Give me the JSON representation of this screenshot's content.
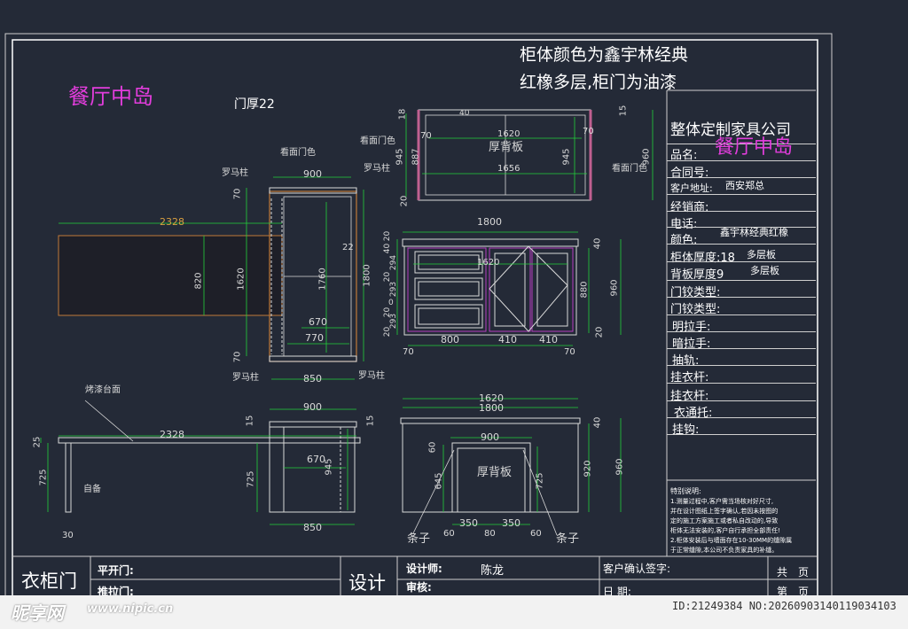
{
  "header": {
    "title_cn": "餐厅中岛",
    "door_thickness": "门厚22",
    "note_line1": "柜体颜色为鑫宇林经典",
    "note_line2": "红橡多层,柜门为油漆"
  },
  "plan_view": {
    "label_look_door_color": "看面门色",
    "label_roman_col_tl": "罗马柱",
    "label_roman_col_tr": "罗马柱",
    "label_roman_col_bl": "罗马柱",
    "label_roman_col_br": "罗马柱",
    "dim_900": "900",
    "dim_2328": "2328",
    "dim_820": "820",
    "dim_1620": "1620",
    "dim_1760": "1760",
    "dim_1800": "1800",
    "dim_22": "22",
    "dim_70_top": "70",
    "dim_70_bot": "70",
    "dim_670": "670",
    "dim_770": "770",
    "dim_850": "850"
  },
  "top_elev": {
    "label_look_door_left": "看面门色",
    "label_back_panel": "厚背板",
    "label_look_door_right": "看面门色",
    "dim_1620": "1620",
    "dim_1656": "1656",
    "dim_70_l": "70",
    "dim_70_r": "70",
    "dim_945_l": "945",
    "dim_945_r": "945",
    "dim_887": "887",
    "dim_960": "960",
    "dim_18": "18",
    "dim_15": "15",
    "dim_20": "20",
    "dim_40": "40"
  },
  "front_elev": {
    "dim_1800": "1800",
    "dim_1620": "1620",
    "dim_800": "800",
    "dim_410a": "410",
    "dim_410b": "410",
    "dim_70_l": "70",
    "dim_70_r": "70",
    "dim_40": "40",
    "dim_880": "880",
    "dim_960": "960",
    "dim_20": "20",
    "left_dims": [
      "20",
      "40",
      "294",
      "20",
      "293",
      "0",
      "20",
      "293",
      "20"
    ]
  },
  "side_elev": {
    "label_paint_top": "烤漆台面",
    "label_self_prep": "自备",
    "dim_2328": "2328",
    "dim_900": "900",
    "dim_670": "670",
    "dim_945": "945",
    "dim_725_l": "725",
    "dim_725_r": "725",
    "dim_850": "850",
    "dim_25": "25",
    "dim_30": "30",
    "dim_15_l": "15",
    "dim_15_r": "15"
  },
  "back_elev": {
    "dim_1620": "1620",
    "dim_1800": "1800",
    "dim_900": "900",
    "label_back_panel": "厚背板",
    "dim_60a": "60",
    "dim_645": "645",
    "dim_725": "725",
    "dim_920": "920",
    "dim_960": "960",
    "dim_40": "40",
    "dim_350a": "350",
    "dim_350b": "350",
    "dim_60b": "60",
    "dim_80": "80",
    "dim_60c": "60",
    "label_bar_l": "条子",
    "label_bar_r": "条子"
  },
  "title_block": {
    "company": "整体定制家具公司",
    "product_name_label": "品名:",
    "product_name_value": "餐厅中岛",
    "contract_no": "合同号:",
    "customer_addr_label": "客户地址:",
    "customer_addr_value": "西安郑总",
    "dealer": "经销商:",
    "phone": "电话:",
    "color_label": "颜色:",
    "color_value": "鑫宇林经典红橡",
    "cabinet_thickness_label": "柜体厚度:18",
    "cabinet_thickness_value": "多层板",
    "back_thickness_label": "背板厚度9",
    "back_thickness_value": "多层板",
    "hinge_type1": "门铰类型:",
    "hinge_type2": "门铰类型:",
    "exposed_handle": "明拉手:",
    "hidden_handle": "暗拉手:",
    "drawer_rail": "抽轨:",
    "hanging_rod1": "挂衣杆:",
    "hanging_rod2": "挂衣杆:",
    "wardrobe_rack": "衣通托:",
    "hook": "挂钩:",
    "notes_title": "特别说明:",
    "notes_body": [
      "1.测量过程中,客户需当场核对好尺寸,",
      "并在设计图纸上签字确认,若因未按图的",
      "定的施工方案施工或者私自改动的,导致",
      "柜体无法安装的,客户自行承担全部责任!",
      "2.柜体安装后与墙面存在10-30MM的缝隙属",
      "于正常缝隙,本公司不负责家具的补缝。"
    ]
  },
  "bottom_bar": {
    "wardrobe_door": "衣柜门",
    "flat_door": "平开门:",
    "sliding_door": "推拉门:",
    "design": "设计",
    "designer_label": "设计师:",
    "designer_name": "陈龙",
    "review_label": "审核:",
    "customer_confirm": "客户确认签字:",
    "date_label": "日  期:",
    "total_label": "共",
    "page_label": "页",
    "page_no": "第",
    "page_label2": "页"
  },
  "watermark": {
    "site": "昵享网",
    "url": "www.nipic.cn",
    "id_text": "ID:21249384 NO:20260903140119034103"
  }
}
